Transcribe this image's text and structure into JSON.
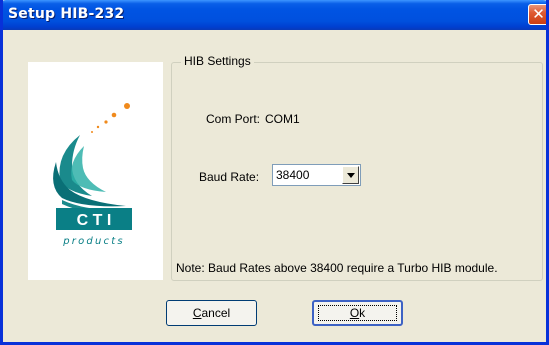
{
  "window": {
    "title": "Setup HIB-232",
    "close_symbol": "✕"
  },
  "logo": {
    "brand": "C T I",
    "tagline": "products",
    "colors": {
      "teal": "#1a8a8c",
      "orange": "#f08a1c",
      "block": "#0a7f86"
    }
  },
  "hib_settings": {
    "legend": "HIB Settings",
    "com_port_label": "Com Port:",
    "com_port_value": "COM1",
    "baud_rate_label": "Baud Rate:",
    "baud_rate_value": "38400",
    "note": "Note: Baud Rates above 38400 require a Turbo HIB module."
  },
  "buttons": {
    "cancel_label": "Cancel",
    "ok_label": "Ok"
  },
  "colors": {
    "titlebar_blue": "#0054e3",
    "dialog_bg": "#ece9d8",
    "close_red": "#df5b33"
  }
}
